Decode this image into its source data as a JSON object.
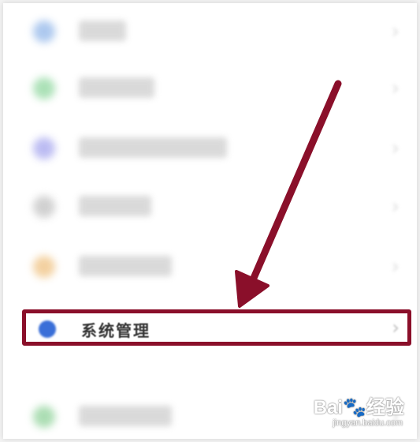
{
  "settings": {
    "items": [
      {
        "icon": "blurred-blue-icon",
        "icon_color": "#a9c6ee"
      },
      {
        "icon": "blurred-green-icon",
        "icon_color": "#a8e0b4"
      },
      {
        "icon": "blurred-purple-icon",
        "icon_color": "#b9b9f2"
      },
      {
        "icon": "blurred-gray-icon",
        "icon_color": "#cfcfcf"
      },
      {
        "icon": "blurred-orange-icon",
        "icon_color": "#f3cf9c"
      },
      {
        "icon": "blurred-green-icon",
        "icon_color": "#a8dcb0"
      }
    ],
    "highlighted": {
      "label": "系统管理",
      "icon": "system-management-icon",
      "icon_color": "#3a6fd8",
      "chevron": "›"
    },
    "chevron": "›"
  },
  "annotation": {
    "color": "#8a0f2a"
  },
  "watermark": {
    "brand": "Bai",
    "suffix": "经验",
    "url": "jingyan.baidu.com"
  }
}
